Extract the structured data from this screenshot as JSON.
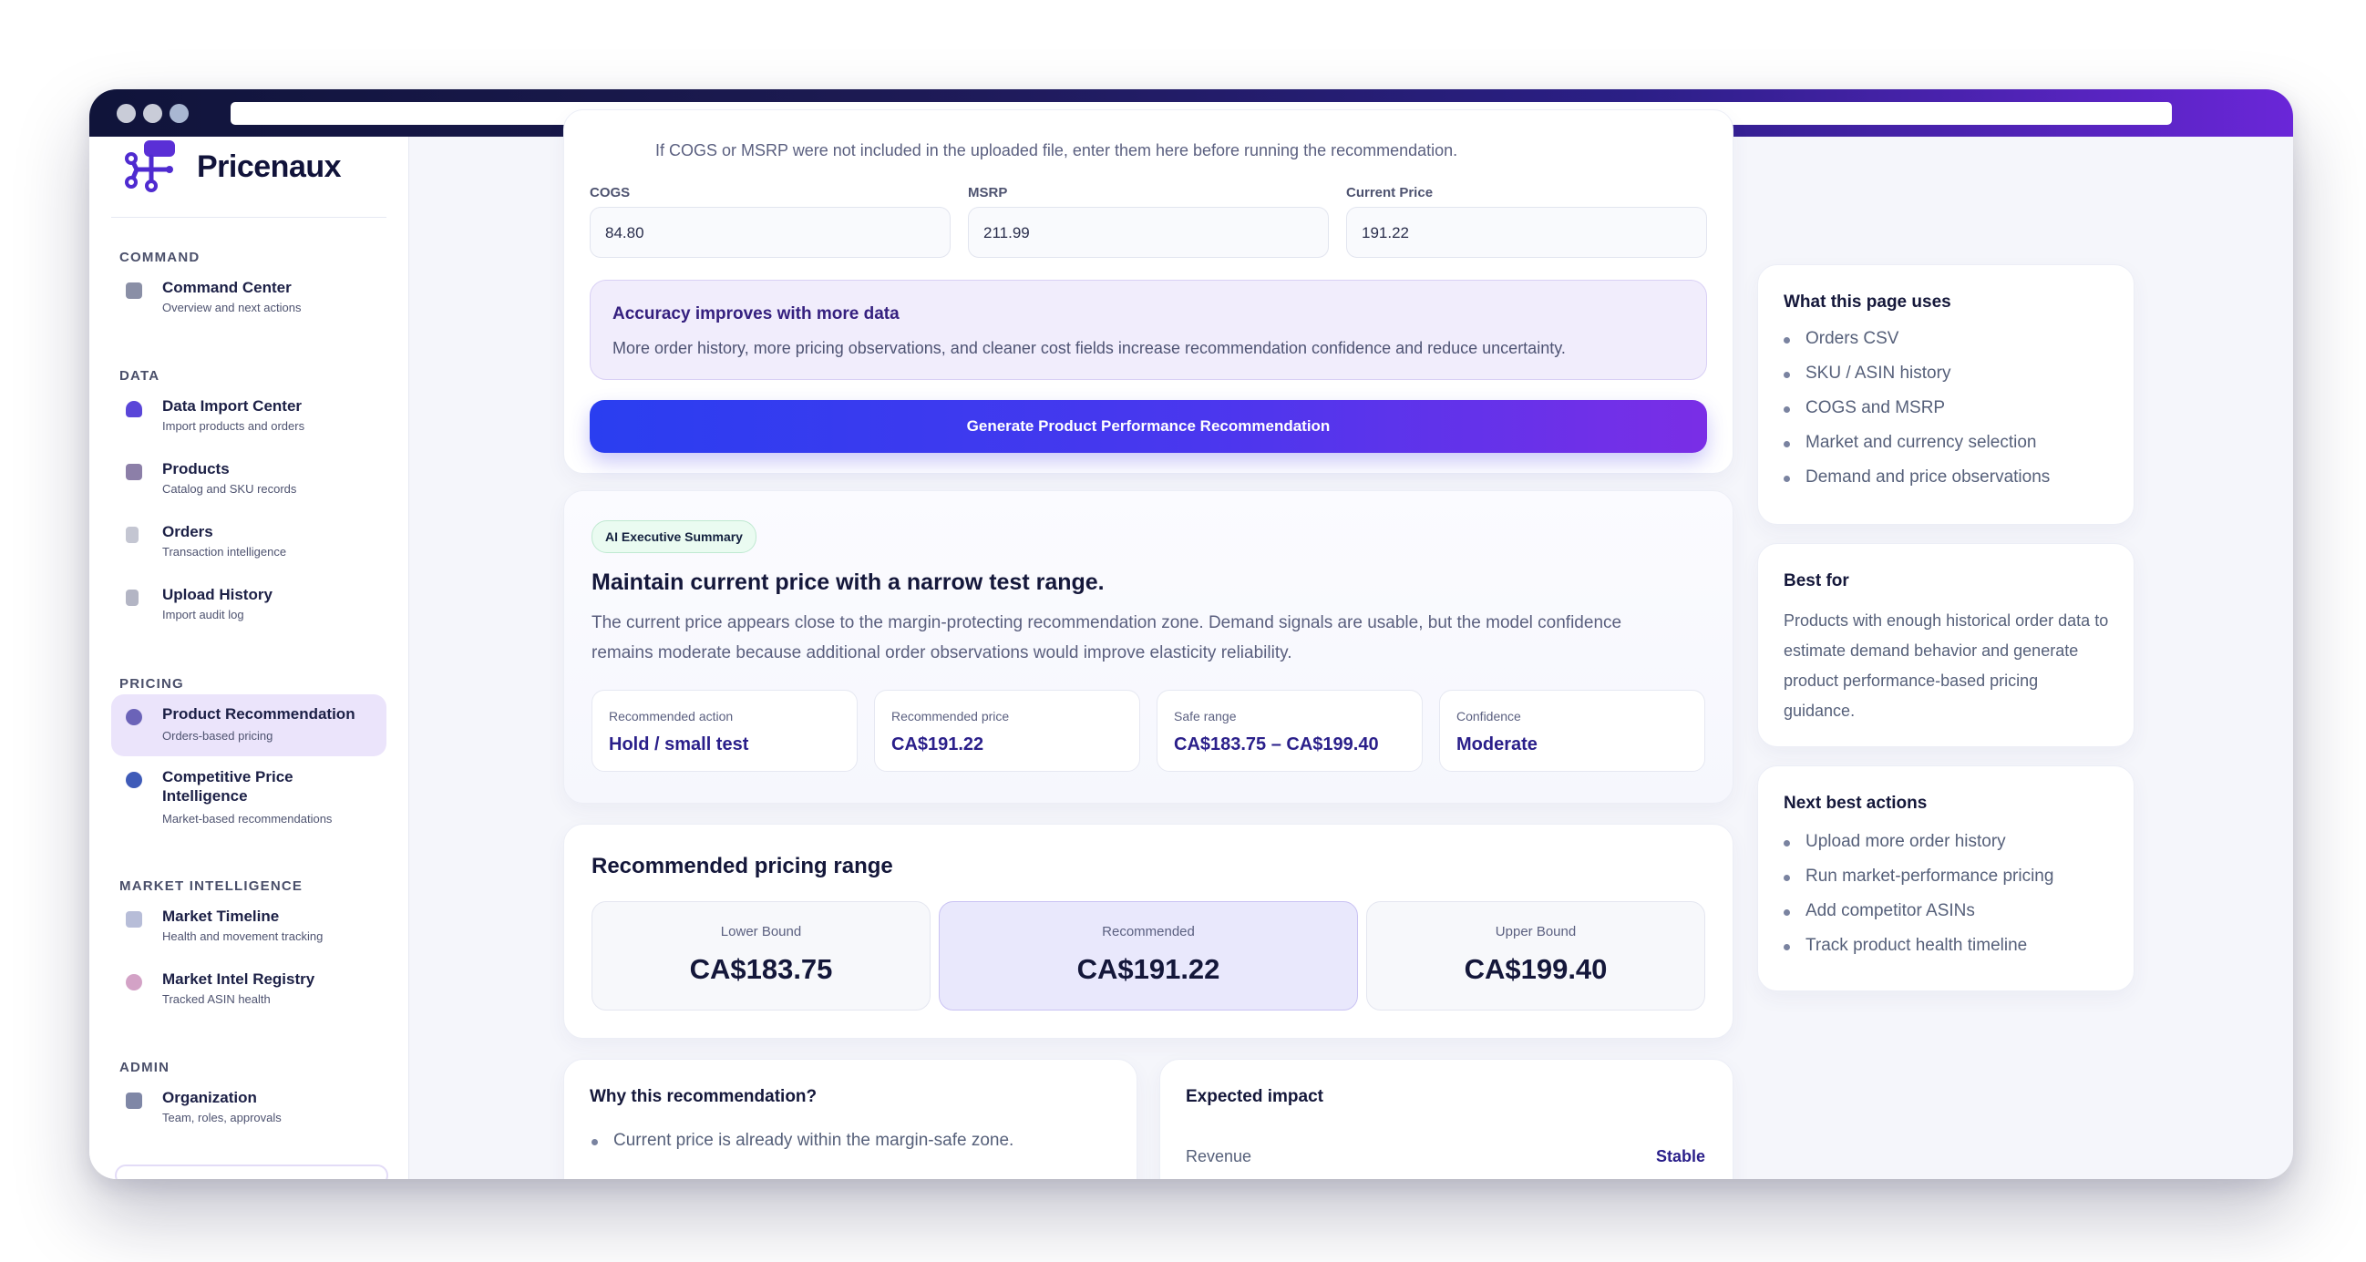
{
  "app": {
    "name": "Pricenaux"
  },
  "sidebar": {
    "sections": {
      "command": "COMMAND",
      "data": "DATA",
      "pricing": "PRICING",
      "market": "MARKET INTELLIGENCE",
      "admin": "ADMIN"
    },
    "items": [
      {
        "title": "Command Center",
        "sub": "Overview and next actions",
        "icon": "command-center-icon",
        "color": "#8a8fa6"
      },
      {
        "title": "Data Import Center",
        "sub": "Import products and orders",
        "icon": "import-icon",
        "color": "#5a46d8"
      },
      {
        "title": "Products",
        "sub": "Catalog and SKU records",
        "icon": "box-icon",
        "color": "#8c7fa8"
      },
      {
        "title": "Orders",
        "sub": "Transaction intelligence",
        "icon": "receipt-icon",
        "color": "#b7b9c6"
      },
      {
        "title": "Upload History",
        "sub": "Import audit log",
        "icon": "scroll-icon",
        "color": "#a7a9b8"
      },
      {
        "title": "Product Recommendation",
        "sub": "Orders-based pricing",
        "icon": "target-icon",
        "color": "#6b63b8"
      },
      {
        "title": "Competitive Price Intelligence",
        "sub": "Market-based recommendations",
        "icon": "globe-icon",
        "color": "#3f5bb8"
      },
      {
        "title": "Market Timeline",
        "sub": "Health and movement tracking",
        "icon": "chart-icon",
        "color": "#9ba3c9"
      },
      {
        "title": "Market Intel Registry",
        "sub": "Tracked ASIN health",
        "icon": "brain-icon",
        "color": "#c48fb5"
      },
      {
        "title": "Organization",
        "sub": "Team, roles, approvals",
        "icon": "building-icon",
        "color": "#7f87a6"
      }
    ]
  },
  "inputs": {
    "hint": "If COGS or MSRP were not included in the uploaded file, enter them here before running the recommendation.",
    "cogs_label": "COGS",
    "cogs_value": "84.80",
    "msrp_label": "MSRP",
    "msrp_value": "211.99",
    "price_label": "Current Price",
    "price_value": "191.22",
    "note_title": "Accuracy improves with more data",
    "note_body": "More order history, more pricing observations, and cleaner cost fields increase recommendation confidence and reduce uncertainty.",
    "button": "Generate Product Performance Recommendation"
  },
  "summary": {
    "badge": "AI Executive Summary",
    "headline": "Maintain current price with a narrow test range.",
    "body_line1": "The current price appears close to the margin-protecting recommendation zone. Demand signals are usable, but the model confidence",
    "body_line2": "remains moderate because additional order observations would improve elasticity reliability.",
    "metrics": [
      {
        "label": "Recommended action",
        "value": "Hold / small test"
      },
      {
        "label": "Recommended price",
        "value": "CA$191.22"
      },
      {
        "label": "Safe range",
        "value": "CA$183.75 – CA$199.40"
      },
      {
        "label": "Confidence",
        "value": "Moderate"
      }
    ]
  },
  "range": {
    "title": "Recommended pricing range",
    "lower_label": "Lower Bound",
    "lower_value": "CA$183.75",
    "rec_label": "Recommended",
    "rec_value": "CA$191.22",
    "upper_label": "Upper Bound",
    "upper_value": "CA$199.40"
  },
  "why": {
    "title": "Why this recommendation?",
    "bullet1": "Current price is already within the margin-safe zone."
  },
  "impact": {
    "title": "Expected impact",
    "row_label": "Revenue",
    "row_value": "Stable"
  },
  "right": {
    "uses_title": "What this page uses",
    "uses": [
      "Orders CSV",
      "SKU / ASIN history",
      "COGS and MSRP",
      "Market and currency selection",
      "Demand and price observations"
    ],
    "best_title": "Best for",
    "best_body": "Products with enough historical order data to estimate demand behavior and generate product performance-based pricing guidance.",
    "next_title": "Next best actions",
    "next": [
      "Upload more order history",
      "Run market-performance pricing",
      "Add competitor ASINs",
      "Track product health timeline"
    ]
  }
}
